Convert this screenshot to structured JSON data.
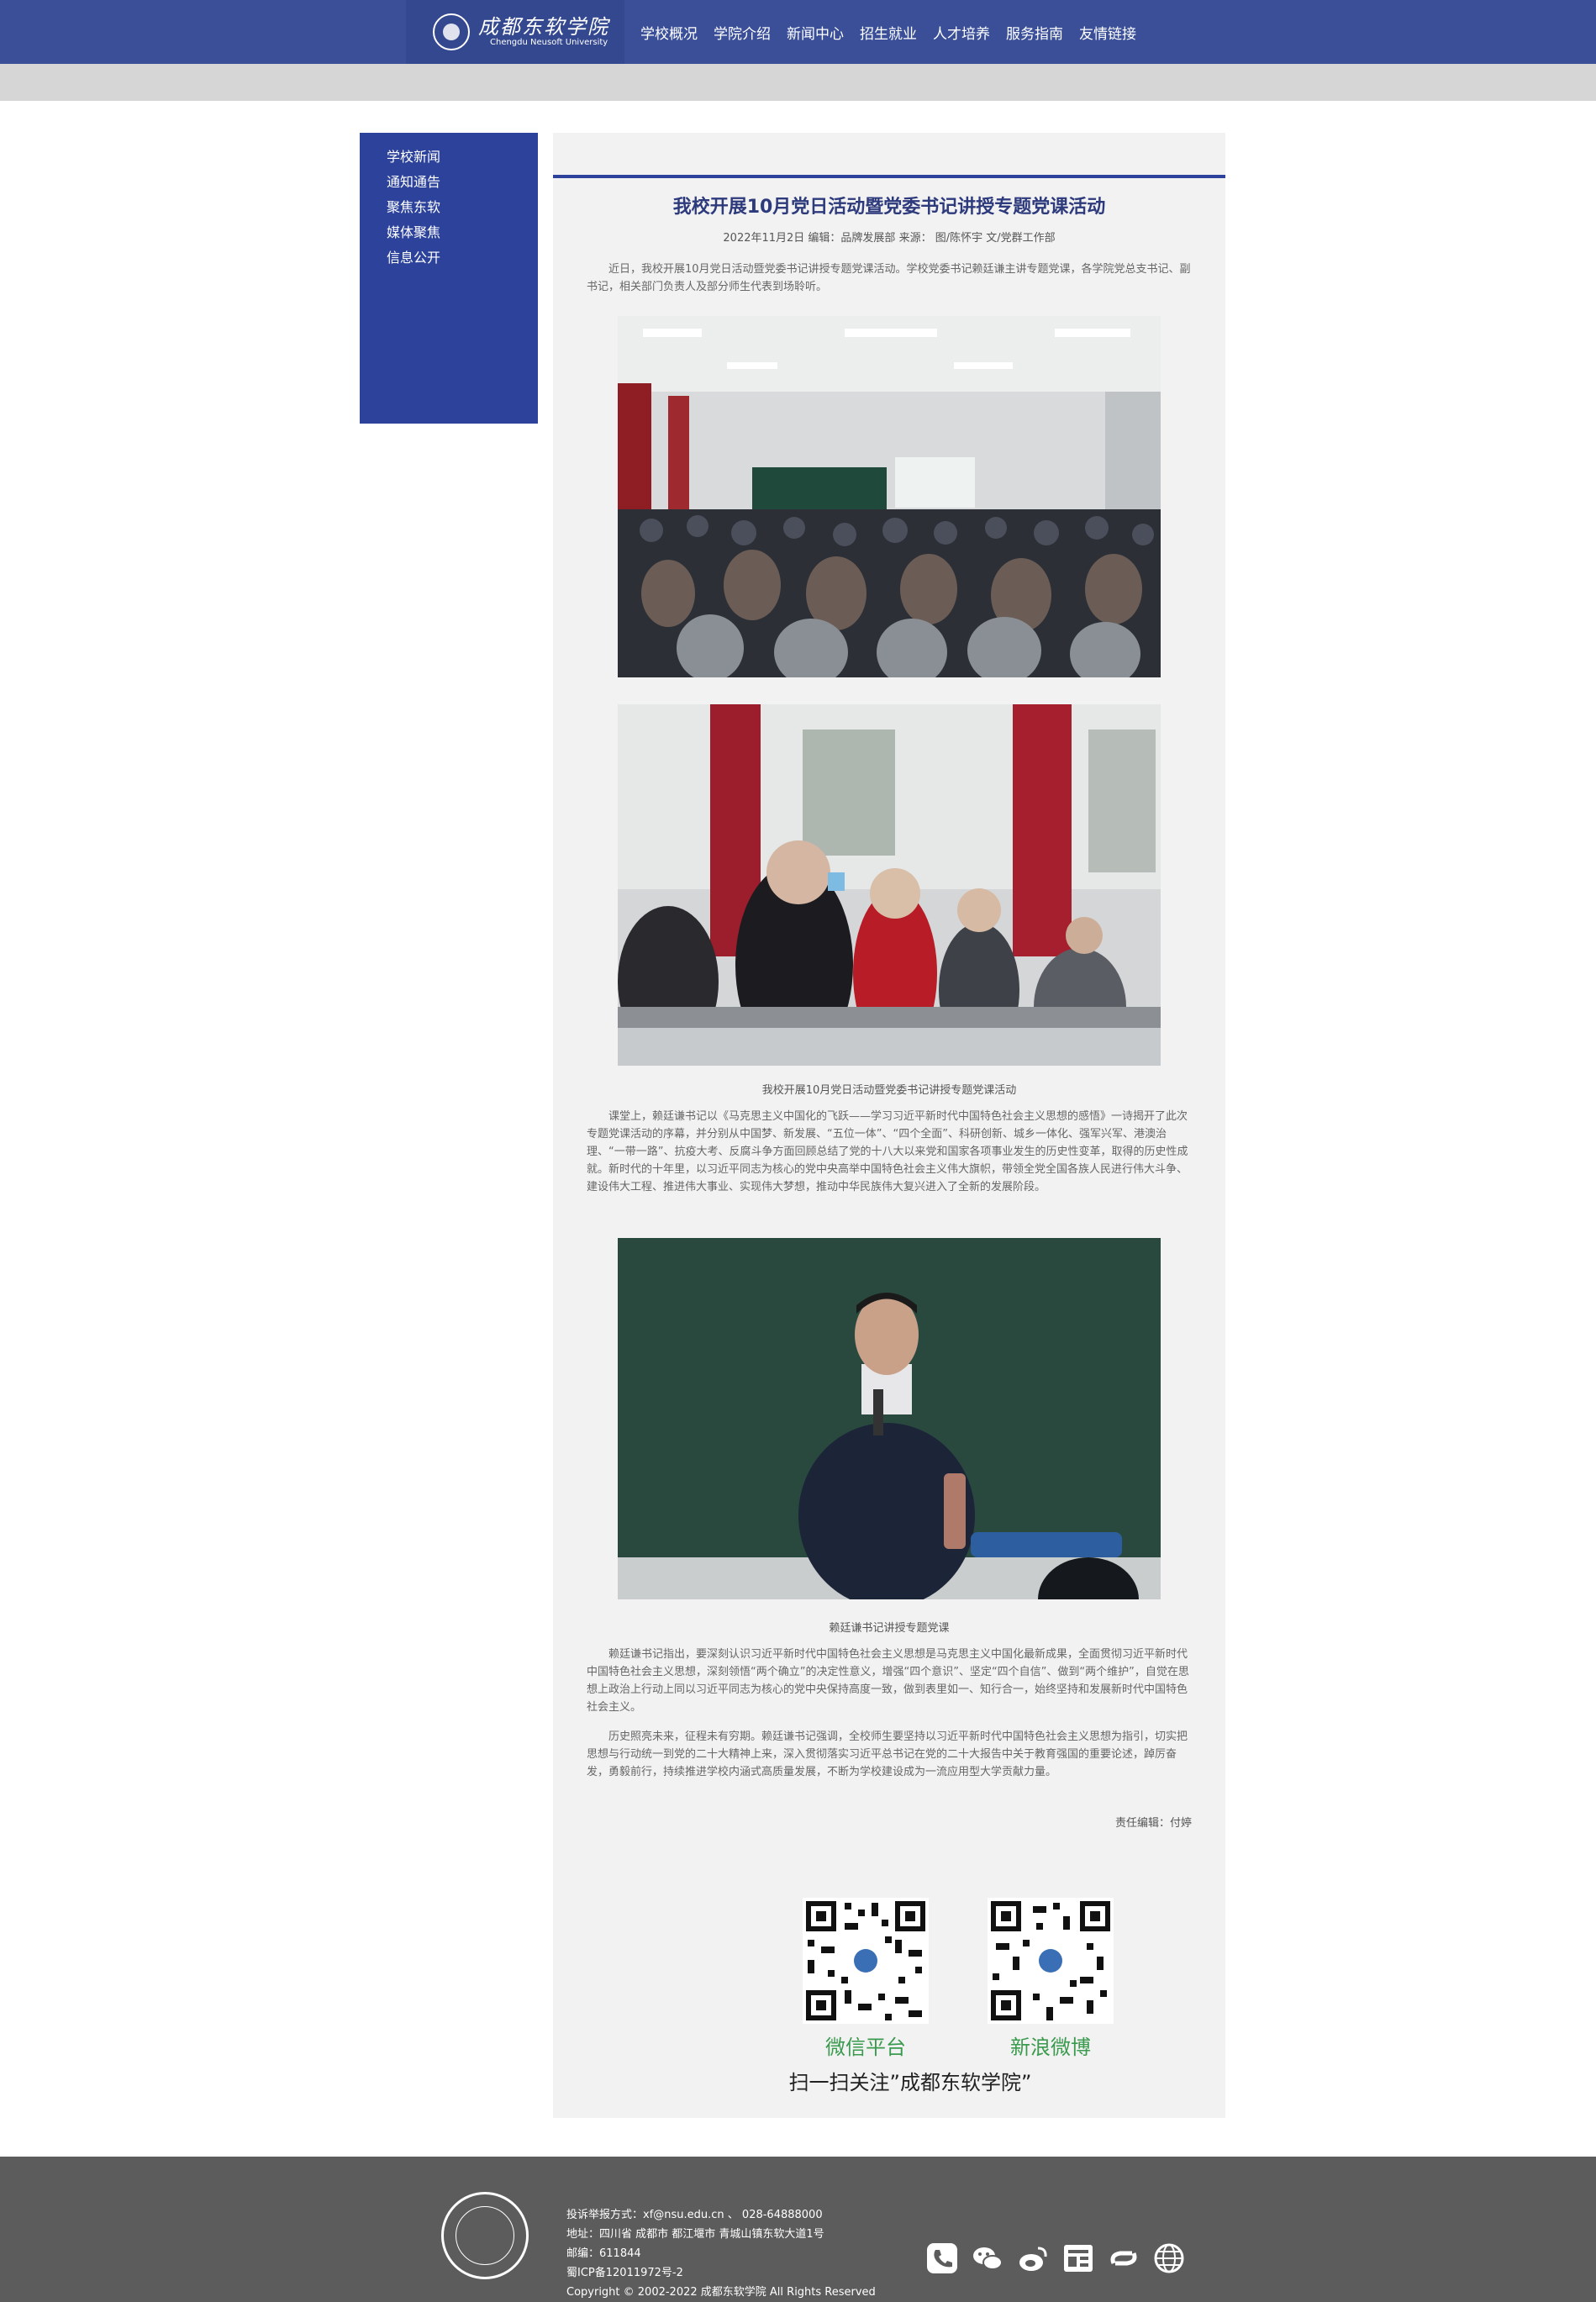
{
  "header": {
    "logo_cn": "成都东软学院",
    "logo_en": "Chengdu Neusoft University",
    "nav": [
      "学校概况",
      "学院介绍",
      "新闻中心",
      "招生就业",
      "人才培养",
      "服务指南",
      "友情链接"
    ]
  },
  "sidebar": {
    "items": [
      "学校新闻",
      "通知通告",
      "聚焦东软",
      "媒体聚焦",
      "信息公开"
    ]
  },
  "article": {
    "title": "我校开展10月党日活动暨党委书记讲授专题党课活动",
    "meta": "2022年11月2日 编辑：品牌发展部 来源： 图/陈怀宇 文/党群工作部",
    "para1": "近日，我校开展10月党日活动暨党委书记讲授专题党课活动。学校党委书记赖廷谦主讲专题党课，各学院党总支书记、副书记，相关部门负责人及部分师生代表到场聆听。",
    "caption1": "我校开展10月党日活动暨党委书记讲授专题党课活动",
    "para2": "课堂上，赖廷谦书记以《马克思主义中国化的飞跃——学习习近平新时代中国特色社会主义思想的感悟》一诗揭开了此次专题党课活动的序幕，并分别从中国梦、新发展、“五位一体”、“四个全面”、科研创新、城乡一体化、强军兴军、港澳治理、“一带一路”、抗疫大考、反腐斗争方面回顾总结了党的十八大以来党和国家各项事业发生的历史性变革，取得的历史性成就。新时代的十年里，以习近平同志为核心的党中央高举中国特色社会主义伟大旗帜，带领全党全国各族人民进行伟大斗争、建设伟大工程、推进伟大事业、实现伟大梦想，推动中华民族伟大复兴进入了全新的发展阶段。",
    "caption2": "赖廷谦书记讲授专题党课",
    "para3": "赖廷谦书记指出，要深刻认识习近平新时代中国特色社会主义思想是马克思主义中国化最新成果，全面贯彻习近平新时代中国特色社会主义思想，深刻领悟“两个确立”的决定性意义，增强“四个意识”、坚定“四个自信”、做到“两个维护”，自觉在思想上政治上行动上同以习近平同志为核心的党中央保持高度一致，做到表里如一、知行合一，始终坚持和发展新时代中国特色社会主义。",
    "para4": "历史照亮未来，征程未有穷期。赖廷谦书记强调，全校师生要坚持以习近平新时代中国特色社会主义思想为指引，切实把思想与行动统一到党的二十大精神上来，深入贯彻落实习近平总书记在党的二十大报告中关于教育强国的重要论述，踔厉奋发，勇毅前行，持续推进学校内涵式高质量发展，不断为学校建设成为一流应用型大学贡献力量。",
    "editor": "责任编辑：付婷"
  },
  "qr": {
    "wechat_label": "微信平台",
    "weibo_label": "新浪微博",
    "slogan": "扫一扫关注”成都东软学院”"
  },
  "footer": {
    "report": "投诉举报方式：xf@nsu.edu.cn 、 028-64888000",
    "address": "地址：四川省 成都市 都江堰市 青城山镇东软大道1号",
    "postcode": "邮编：611844",
    "icp": "蜀ICP备12011972号-2",
    "copyright": "Copyright © 2002-2022 成都东软学院 All Rights Reserved",
    "icons": [
      "phone-icon",
      "wechat-icon",
      "weibo-icon",
      "toutiao-icon",
      "link-icon",
      "globe-icon"
    ]
  },
  "colors": {
    "header_blue": "#3a4f98",
    "sidebar_blue": "#2d439b",
    "title_blue": "#2d3a7c",
    "qr_green": "#3a9a4e",
    "footer_grey": "#5c5c5c"
  }
}
